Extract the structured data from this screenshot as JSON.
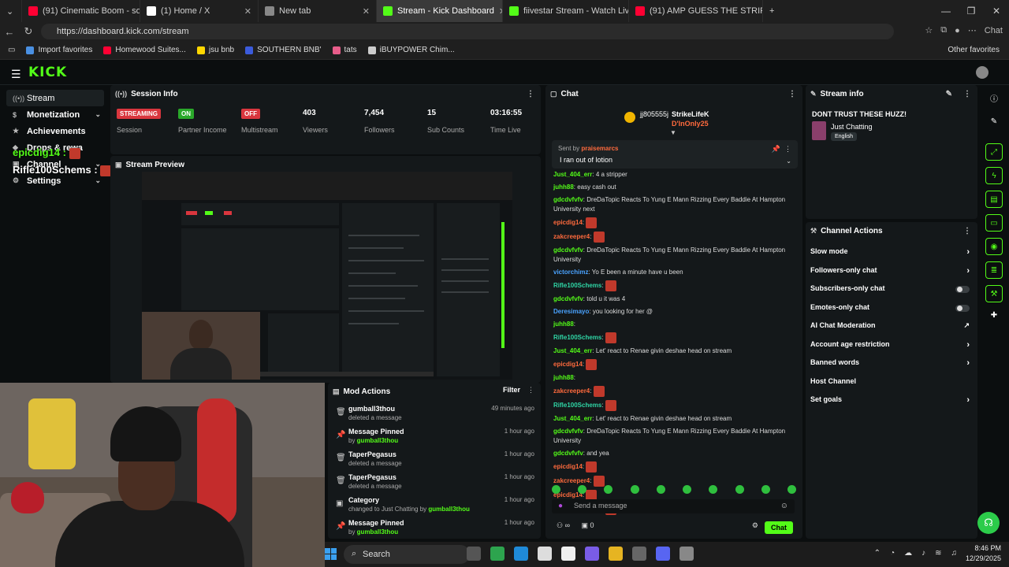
{
  "browser": {
    "tabs": [
      {
        "label": "(91) Cinematic Boom - sound effe",
        "color": "#ff0033"
      },
      {
        "label": "(1) Home / X",
        "color": "#ffffff"
      },
      {
        "label": "New tab",
        "color": "#888888"
      },
      {
        "label": "Stream - Kick Dashboard",
        "color": "#53fc18"
      },
      {
        "label": "fiivestar Stream - Watch Live on Ki",
        "color": "#53fc18"
      },
      {
        "label": "(91) AMP GUESS THE STRIPPER - Y",
        "color": "#ff0033"
      }
    ],
    "new_tab_label": "+",
    "url": "https://dashboard.kick.com/stream",
    "chat_label": "Chat",
    "bookmarks": [
      "Import favorites",
      "Homewood Suites...",
      "jsu bnb",
      "SOUTHERN BNB'",
      "tats",
      "iBUYPOWER Chim..."
    ],
    "other_favorites": "Other favorites"
  },
  "kick": {
    "logo": "KICK",
    "accent": "#53fc18"
  },
  "sidenav": {
    "items": [
      {
        "label": "Stream",
        "chevron": ""
      },
      {
        "label": "Monetization",
        "chevron": "⌄"
      },
      {
        "label": "Achievements",
        "chevron": ""
      },
      {
        "label": "Drops & rewa",
        "chevron": ""
      },
      {
        "label": "Channel",
        "chevron": "⌄"
      },
      {
        "label": "Settings",
        "chevron": "⌄"
      }
    ]
  },
  "overlay": {
    "name1": "epicdig14 :",
    "name2": "Rifle100Schems :"
  },
  "session": {
    "title": "Session Info",
    "stats": [
      {
        "badge": "STREAMING",
        "badge_color": "#d9363e",
        "label": "Session"
      },
      {
        "badge": "ON",
        "badge_color": "#2aa82a",
        "label": "Partner Income"
      },
      {
        "badge": "OFF",
        "badge_color": "#d9363e",
        "label": "Multistream"
      },
      {
        "num": "403",
        "label": "Viewers"
      },
      {
        "num": "7,454",
        "label": "Followers"
      },
      {
        "num": "15",
        "label": "Sub Counts"
      },
      {
        "num": "03:16:55",
        "label": "Time Live"
      }
    ]
  },
  "preview": {
    "title": "Stream Preview"
  },
  "mod_actions": {
    "title": "Mod Actions",
    "filter": "Filter",
    "rows": [
      {
        "icon": "trash-icon",
        "title": "gumball3thou",
        "sub": "deleted a message",
        "sub_bold": "",
        "time": "49 minutes ago"
      },
      {
        "icon": "pin-icon",
        "title": "Message Pinned",
        "sub": "by ",
        "sub_bold": "gumball3thou",
        "time": "1 hour ago"
      },
      {
        "icon": "trash-icon",
        "title": "TaperPegasus",
        "sub": "deleted a message",
        "sub_bold": "",
        "time": "1 hour ago"
      },
      {
        "icon": "trash-icon",
        "title": "TaperPegasus",
        "sub": "deleted a message",
        "sub_bold": "",
        "time": "1 hour ago"
      },
      {
        "icon": "category-icon",
        "title": "Category",
        "sub": "changed to Just Chatting by ",
        "sub_bold": "gumball3thou",
        "time": "1 hour ago"
      },
      {
        "icon": "pin-icon",
        "title": "Message Pinned",
        "sub": "by ",
        "sub_bold": "gumball3thou",
        "time": "1 hour ago"
      }
    ]
  },
  "chat": {
    "title": "Chat",
    "top_users": [
      "jj805555j",
      "StrikeLifeK",
      "D'InOnly25"
    ],
    "pinned": {
      "sent_by_prefix": "Sent by ",
      "sent_by": "praisemarcs",
      "message": "I ran out of lotion"
    },
    "messages": [
      {
        "user": "Just_404_err",
        "color": "#53fc18",
        "text": "4 a stripper",
        "emote": false
      },
      {
        "user": "juhh88",
        "color": "#53fc18",
        "text": "easy cash out",
        "emote": false
      },
      {
        "user": "gdcdvfvfv",
        "color": "#53fc18",
        "text": "DreDaTopic Reacts To Yung E Mann Rizzing Every Baddie At Hampton University next",
        "emote": false
      },
      {
        "user": "epicdig14",
        "color": "#ff6a3d",
        "text": "",
        "emote": true
      },
      {
        "user": "zakcreeper4",
        "color": "#ff6a3d",
        "text": "",
        "emote": true
      },
      {
        "user": "gdcdvfvfv",
        "color": "#53fc18",
        "text": "DreDaTopic Reacts To Yung E Mann Rizzing Every Baddie At Hampton University",
        "emote": false
      },
      {
        "user": "victorchimz",
        "color": "#4aa3ff",
        "text": "Yo E been a minute have u been",
        "emote": false
      },
      {
        "user": "Rifle100Schems",
        "color": "#2fd6a6",
        "text": "",
        "emote": true
      },
      {
        "user": "gdcdvfvfv",
        "color": "#53fc18",
        "text": "told u it was 4",
        "emote": false
      },
      {
        "user": "Deresimayo",
        "color": "#4aa3ff",
        "text": "you looking for her @",
        "emote": false
      },
      {
        "user": "juhh88",
        "color": "#53fc18",
        "text": "",
        "emote": false
      },
      {
        "user": "Rifle100Schems",
        "color": "#2fd6a6",
        "text": "",
        "emote": true
      },
      {
        "user": "Just_404_err",
        "color": "#53fc18",
        "text": "Let' react to Renae givin deshae head on stream",
        "emote": false
      },
      {
        "user": "epicdig14",
        "color": "#ff6a3d",
        "text": "",
        "emote": true
      },
      {
        "user": "juhh88",
        "color": "#53fc18",
        "text": "",
        "emote": false
      },
      {
        "user": "zakcreeper4",
        "color": "#ff6a3d",
        "text": "",
        "emote": true
      },
      {
        "user": "Rifle100Schems",
        "color": "#2fd6a6",
        "text": "",
        "emote": true
      },
      {
        "user": "Just_404_err",
        "color": "#53fc18",
        "text": "Let' react to Renae givin deshae head on stream",
        "emote": false
      },
      {
        "user": "gdcdvfvfv",
        "color": "#53fc18",
        "text": "DreDaTopic Reacts To Yung E Mann Rizzing Every Baddie At Hampton University",
        "emote": false
      },
      {
        "user": "gdcdvfvfv",
        "color": "#53fc18",
        "text": "and yea",
        "emote": false
      },
      {
        "user": "epicdig14",
        "color": "#ff6a3d",
        "text": "",
        "emote": true
      },
      {
        "user": "zakcreeper4",
        "color": "#ff6a3d",
        "text": "",
        "emote": true
      },
      {
        "user": "epicdig14",
        "color": "#ff6a3d",
        "text": "",
        "emote": true
      },
      {
        "user": "Rifle100Schems",
        "color": "#2fd6a6",
        "text": "",
        "emote": true
      }
    ],
    "placeholder": "Send a message",
    "footer_count": "0",
    "chat_button": "Chat"
  },
  "stream_info": {
    "title": "Stream info",
    "stream_title": "DONT TRUST THESE HUZZ!",
    "category": "Just Chatting",
    "language": "English"
  },
  "channel_actions": {
    "title": "Channel Actions",
    "items": [
      {
        "label": "Slow mode",
        "kind": "chevron"
      },
      {
        "label": "Followers-only chat",
        "kind": "chevron"
      },
      {
        "label": "Subscribers-only chat",
        "kind": "toggle"
      },
      {
        "label": "Emotes-only chat",
        "kind": "toggle"
      },
      {
        "label": "AI Chat Moderation",
        "kind": "external"
      },
      {
        "label": "Account age restriction",
        "kind": "chevron"
      },
      {
        "label": "Banned words",
        "kind": "chevron"
      },
      {
        "label": "Host Channel",
        "kind": "none"
      },
      {
        "label": "Set goals",
        "kind": "chevron"
      }
    ]
  },
  "taskbar": {
    "search": "Search",
    "time": "8:46 PM",
    "date": "12/29/2025"
  }
}
